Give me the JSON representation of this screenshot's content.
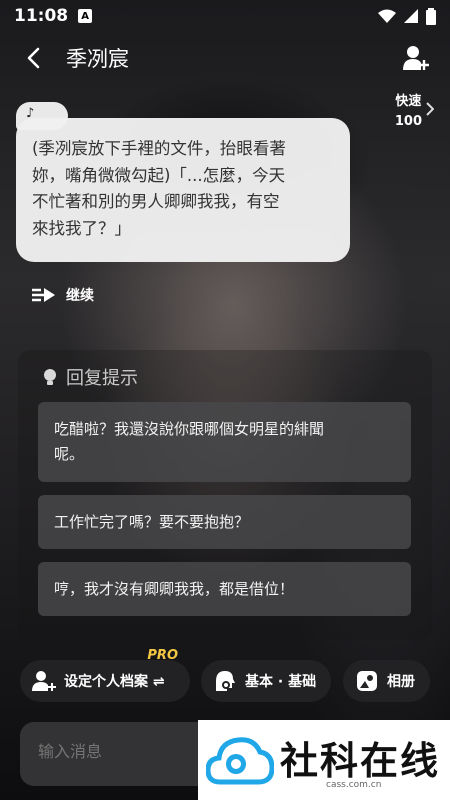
{
  "status": {
    "time": "11:08",
    "notif": "A"
  },
  "header": {
    "title": "季冽宸"
  },
  "speed": {
    "label": "快速",
    "value": "100"
  },
  "bubble": {
    "tag": "♪",
    "lines": [
      "(季冽宸放下手裡的文件，抬眼看著",
      "妳，嘴角微微勾起)「...怎麼，今天",
      "不忙著和別的男人卿卿我我，有空",
      "來找我了？」"
    ]
  },
  "continue_label": "继续",
  "hints": {
    "title": "回复提示",
    "items": [
      {
        "lines": [
          "吃醋啦？我還沒說你跟哪個女明星的緋聞",
          "呢。"
        ]
      },
      {
        "lines": [
          "工作忙完了嗎？要不要抱抱？"
        ]
      },
      {
        "lines": [
          "哼，我才沒有卿卿我我，都是借位！"
        ]
      }
    ]
  },
  "bottom": {
    "profile_label": "设定个人档案 ⇌",
    "pro_badge": "PRO",
    "mode_label": "基本 · 基础",
    "album_label": "相册"
  },
  "input": {
    "placeholder": "输入消息"
  },
  "watermark": {
    "text": "社科在线",
    "sub": "cass.com.cn"
  }
}
